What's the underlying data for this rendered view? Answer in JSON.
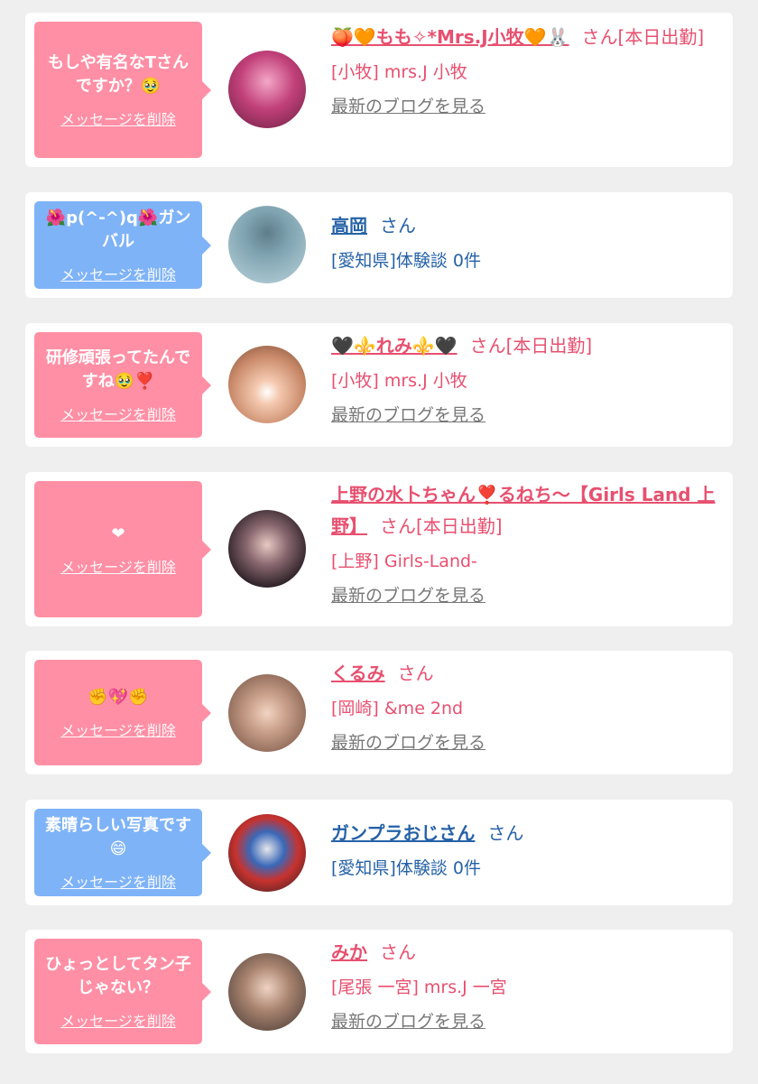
{
  "delete_label": "メッセージを削除",
  "san_label": "さん",
  "blog_label": "最新のブログを見る",
  "colors": {
    "pink_bubble": "#ff8fa5",
    "blue_bubble": "#7fb3f7",
    "pink_text": "#e7506f",
    "blue_text": "#2562a7"
  },
  "items": [
    {
      "message": "もしや有名なTさんですか？🥹",
      "name": "🍑🧡もも✧*Mrs.J小牧🧡🐰",
      "status": "[本日出勤]",
      "shop": "[小牧] mrs.J 小牧",
      "show_blog": true,
      "type": "girl"
    },
    {
      "message": "🌺p(^-^)q🌺ガンバル",
      "name": "高岡",
      "status": "",
      "shop": "[愛知県]体験談 0件",
      "show_blog": false,
      "type": "user"
    },
    {
      "message": "研修頑張ってたんですね🥹❣️",
      "name": "🖤⚜️れみ⚜️🖤",
      "status": "[本日出勤]",
      "shop": "[小牧] mrs.J 小牧",
      "show_blog": true,
      "type": "girl"
    },
    {
      "message": "❤",
      "name": "上野の水卜ちゃん❣️るねち〜【Girls Land 上野】",
      "status": "[本日出勤]",
      "shop": "[上野] Girls-Land-",
      "show_blog": true,
      "type": "girl"
    },
    {
      "message": "✊💖✊",
      "name": "くるみ",
      "status": "",
      "shop": "[岡崎] &me 2nd",
      "show_blog": true,
      "type": "girl"
    },
    {
      "message": "素晴らしい写真です😄",
      "name": "ガンプラおじさん",
      "status": "",
      "shop": "[愛知県]体験談 0件",
      "show_blog": false,
      "type": "user"
    },
    {
      "message": "ひょっとしてタン子じゃない？",
      "name": "みか",
      "status": "",
      "shop": "[尾張 一宮] mrs.J 一宮",
      "show_blog": true,
      "type": "girl"
    }
  ]
}
